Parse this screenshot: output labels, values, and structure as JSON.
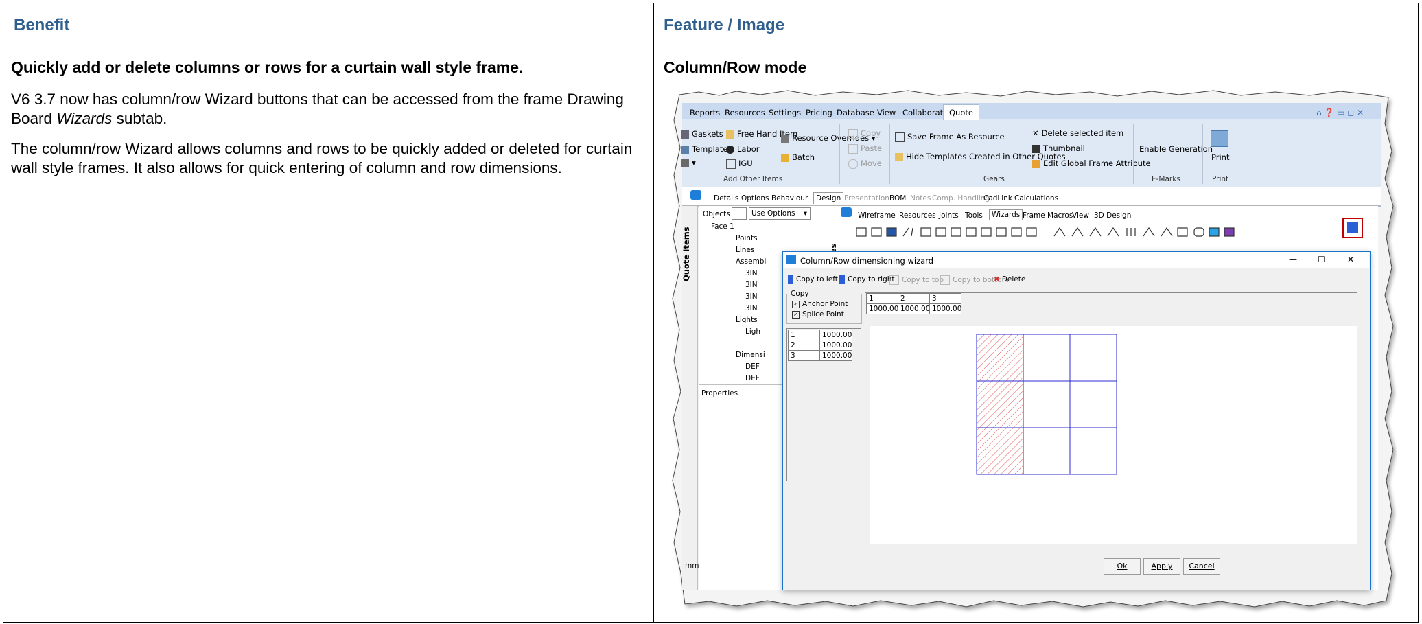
{
  "table": {
    "header_left": "Benefit",
    "header_right": "Feature / Image",
    "row_title_left": "Quickly add or delete columns or rows for a curtain wall style frame.",
    "row_title_right": "Column/Row mode",
    "body_p1_pre": "V6 3.7 now has column/row Wizard buttons that can be accessed from the frame Drawing Board ",
    "body_p1_em": "Wizards",
    "body_p1_post": " subtab.",
    "body_p2": "The column/row Wizard allows columns and rows to be quickly added or deleted for curtain wall style frames. It also allows for quick entering of column and row dimensions."
  },
  "colors": {
    "header_blue": "#2e5f8f",
    "ribbon_bg": "#dfe9f5",
    "highlight_red": "#c00000",
    "grid_blue": "#2b2bd6",
    "hatch_red": "#e05050"
  },
  "screenshot": {
    "ribbon_tabs": [
      "Reports",
      "Resources",
      "Settings",
      "Pricing",
      "Database",
      "View",
      "Collaborate",
      "Quote"
    ],
    "active_tab": "Quote",
    "window_controls": "⌂ ❓ ▭ ◻ ✕",
    "ribbon": {
      "gaskets": "Gaskets",
      "template": "Template",
      "free_hand_item": "Free Hand Item",
      "labor": "Labor",
      "igu": "IGU",
      "resource_overrides": "Resource Overrides",
      "batch": "Batch",
      "add_other_items": "Add Other Items",
      "copy": "Copy",
      "paste": "Paste",
      "move": "Move",
      "save_frame": "Save Frame As Resource",
      "hide_templates": "Hide Templates Created in Other Quotes",
      "gears": "Gears",
      "delete_selected": "Delete selected item",
      "thumbnail": "Thumbnail",
      "edit_global": "Edit Global Frame Attribute",
      "enable_generation": "Enable Generation",
      "emarks": "E-Marks",
      "print": "Print",
      "print_group": "Print"
    },
    "sub_tabs": [
      "Details",
      "Options",
      "Behaviour",
      "Design",
      "Presentation",
      "BOM",
      "Notes",
      "Comp. Handling",
      "CadLink",
      "Calculations"
    ],
    "quote_items_label": "Quote Items",
    "objects_label": "Objects",
    "use_options": "Use Options",
    "tree": [
      "Face 1",
      "Points",
      "Lines",
      "Assembl",
      "3IN",
      "3IN",
      "3IN",
      "3IN",
      "Lights",
      "Ligh",
      "Dimensi",
      "DEF",
      "DEF"
    ],
    "properties_label": "Properties",
    "properties_vertical": "ties",
    "drawing_tabs": [
      "Wireframe",
      "Resources",
      "Joints",
      "Tools",
      "Wizards",
      "Frame Macros",
      "View",
      "3D Design"
    ],
    "mm_label": "mm",
    "dialog": {
      "title": "Column/Row dimensioning wizard",
      "copy_to_left": "Copy to left",
      "copy_to_right": "Copy to right",
      "copy_to_top": "Copy to top",
      "copy_to_bottom": "Copy to bottom",
      "delete": "Delete",
      "copy_group": "Copy",
      "anchor_point": "Anchor Point",
      "splice_point": "Splice Point",
      "col_headers": [
        "1",
        "2",
        "3"
      ],
      "col_values": [
        "1000.00",
        "1000.00",
        "1000.00"
      ],
      "row_headers": [
        "1",
        "2",
        "3"
      ],
      "row_values": [
        "1000.00",
        "1000.00",
        "1000.00"
      ],
      "ok": "Ok",
      "apply": "Apply",
      "cancel": "Cancel",
      "min": "—",
      "max": "☐",
      "close": "✕"
    },
    "grid": {
      "columns": 3,
      "rows": 3,
      "hatched_cells": [
        [
          0,
          0
        ],
        [
          1,
          0
        ],
        [
          2,
          0
        ]
      ]
    }
  }
}
